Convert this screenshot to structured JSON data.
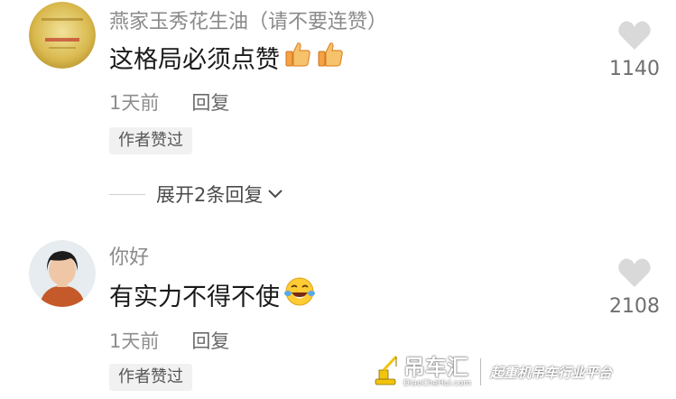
{
  "comments": [
    {
      "username": "燕家玉秀花生油（请不要连赞）",
      "content": "这格局必须点赞",
      "content_emojis": [
        "thumbs-up-icon",
        "thumbs-up-icon"
      ],
      "time": "1天前",
      "reply_label": "回复",
      "badge": "作者赞过",
      "like_count": "1140",
      "expand_label": "展开2条回复"
    },
    {
      "username": "你好",
      "content": "有实力不得不使",
      "content_emojis": [
        "laughing-tears-icon"
      ],
      "time": "1天前",
      "reply_label": "回复",
      "badge": "作者赞过",
      "like_count": "2108"
    }
  ],
  "watermark": {
    "brand": "吊车汇",
    "url": "DiaoCheHui.com",
    "slogan": "起重机吊车行业平台"
  },
  "colors": {
    "username": "#8a8a8a",
    "content": "#1a1a1a",
    "heart": "#d9d9d9",
    "badge_bg": "#f1f1f1"
  }
}
